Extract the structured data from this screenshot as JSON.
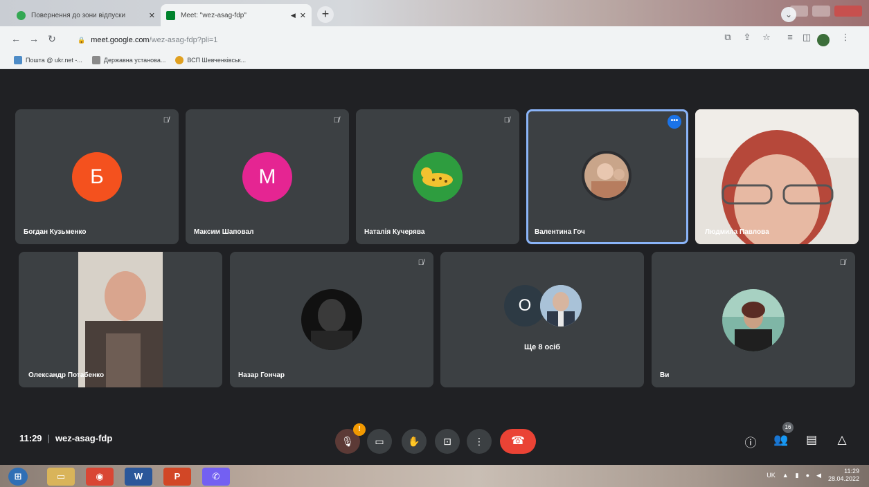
{
  "browser": {
    "tabs": [
      {
        "title": "Повернення до зони відпуски",
        "active": false
      },
      {
        "title": "Meet: \"wez-asag-fdp\"",
        "active": true
      }
    ],
    "new_tab": "+",
    "url_host": "meet.google.com",
    "url_path": "/wez-asag-fdp?pli=1",
    "bookmarks": [
      "Пошта @ ukr.net -...",
      "Державна установа...",
      "ВСП Шевченківськ..."
    ]
  },
  "meet": {
    "participants": [
      {
        "name": "Богдан Кузьменко",
        "initial": "Б",
        "color": "#f4511e"
      },
      {
        "name": "Максим Шаповал",
        "initial": "М",
        "color": "#e52592"
      },
      {
        "name": "Наталія Кучерява"
      },
      {
        "name": "Валентина Гоч"
      },
      {
        "name": "Людмила Павлова"
      },
      {
        "name": "Олександр Потабенко"
      },
      {
        "name": "Назар Гончар"
      },
      {
        "name": "Ви"
      }
    ],
    "others_initial": "О",
    "others_label": "Ще 8 осіб",
    "more_label": "•••"
  },
  "controls": {
    "time": "11:29",
    "separator": "|",
    "meeting_code": "wez-asag-fdp",
    "mic_badge": "!",
    "people_count": "16"
  },
  "taskbar": {
    "lang": "UK",
    "clock_time": "11:29",
    "clock_date": "28.04.2022",
    "apps": [
      "start",
      "explorer",
      "chrome",
      "word",
      "powerpoint",
      "viber"
    ]
  }
}
